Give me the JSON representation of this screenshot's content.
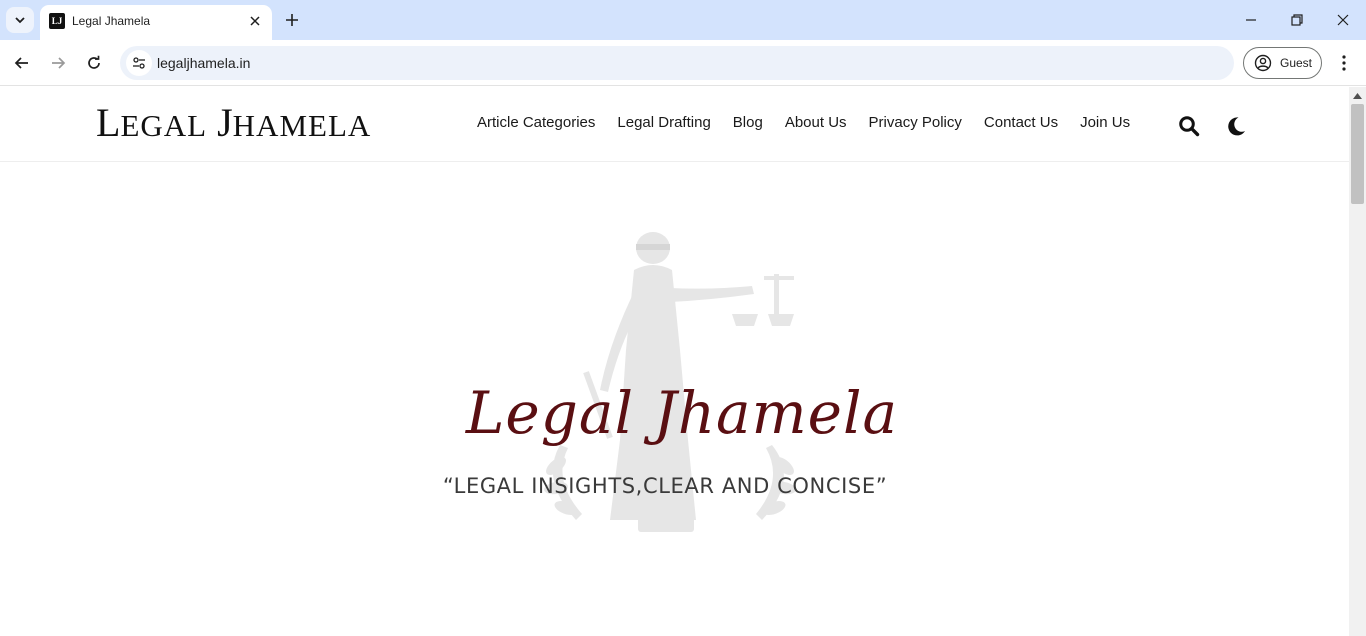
{
  "browser": {
    "tab": {
      "title": "Legal Jhamela",
      "favicon_text": "LJ"
    },
    "url": "legaljhamela.in",
    "profile_label": "Guest",
    "icons": {
      "tab_search": "chevron-down-icon",
      "tab_close": "close-icon",
      "new_tab": "plus-icon",
      "minimize": "minimize-icon",
      "restore": "restore-icon",
      "close_window": "close-icon",
      "back": "arrow-left-icon",
      "forward": "arrow-right-icon",
      "reload": "reload-icon",
      "site_info": "tune-icon",
      "profile": "account-circle-icon",
      "menu": "more-vert-icon"
    }
  },
  "site": {
    "logo": {
      "first_cap": "L",
      "first_rest": "EGAL",
      "second_cap": "J",
      "second_rest": "HAMELA"
    },
    "nav": [
      "Article Categories",
      "Legal Drafting",
      "Blog",
      "About Us",
      "Privacy Policy",
      "Contact Us",
      "Join Us"
    ],
    "icons": {
      "search": "search-icon",
      "theme_toggle": "moon-icon"
    }
  },
  "hero": {
    "brand": "Legal Jhamela",
    "tagline": "“LEGAL INSIGHTS,CLEAR AND CONCISE”",
    "watermark": "lady-justice-icon"
  },
  "colors": {
    "tabstrip": "#d3e3fd",
    "omnibox": "#edf2fa",
    "brand_maroon": "#5a0f12",
    "tagline": "#3a3a3a",
    "watermark": "#e6e6e6"
  }
}
